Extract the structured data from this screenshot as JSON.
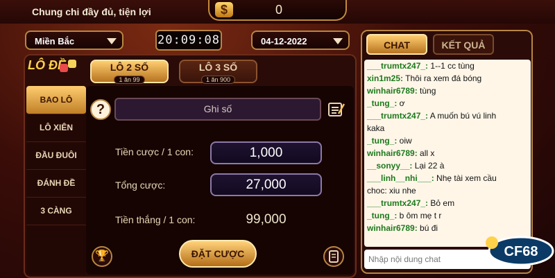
{
  "header": {
    "tagline": "Chung chi đầy đủ, tiện lợi",
    "currency_symbol": "$",
    "balance": "0"
  },
  "selectors": {
    "region": "Miền Bắc",
    "clock": "20:09:08",
    "date": "04-12-2022"
  },
  "brand": {
    "logo": "LÔ ĐỀ"
  },
  "tabs": [
    {
      "label": "LÔ 2 SỐ",
      "sub": "1 ăn 99"
    },
    {
      "label": "LÔ 3 SỐ",
      "sub": "1 ăn 900"
    }
  ],
  "sidebar": {
    "items": [
      {
        "label": "BAO LÔ"
      },
      {
        "label": "LÔ XIÊN"
      },
      {
        "label": "ĐẦU ĐUÔI"
      },
      {
        "label": "ĐÁNH ĐỀ"
      },
      {
        "label": "3 CÀNG"
      }
    ]
  },
  "form": {
    "ghi_so_placeholder": "Ghi số",
    "bet_per_label": "Tiền cược / 1 con:",
    "bet_per_value": "1,000",
    "total_label": "Tổng cược:",
    "total_value": "27,000",
    "win_label": "Tiền thắng / 1 con:",
    "win_value": "99,000",
    "submit": "ĐẶT CƯỢC"
  },
  "chat": {
    "tabs": [
      "CHAT",
      "KẾT QUẢ"
    ],
    "messages": [
      {
        "user": "___trumtx247_:",
        "text": " 1--1 cc tùng"
      },
      {
        "user": "xin1m25:",
        "text": " Thôi ra xem đá bóng"
      },
      {
        "user": "winhair6789:",
        "text": " tùng"
      },
      {
        "user": "_tung_:",
        "text": " ơ"
      },
      {
        "user": "___trumtx247_:",
        "text": " A muốn bú vú linh"
      },
      {
        "user": "",
        "text": "kaka"
      },
      {
        "user": "_tung_:",
        "text": " oiw"
      },
      {
        "user": "winhair6789:",
        "text": " all x"
      },
      {
        "user": "__sonyy__:",
        "text": " Lại 22 à"
      },
      {
        "user": "___linh__nhi___:",
        "text": " Nhẹ tài xem cầu"
      },
      {
        "user": "",
        "text": "choc: xiu nhe"
      },
      {
        "user": "___trumtx247_:",
        "text": " Bỏ em"
      },
      {
        "user": "_tung_:",
        "text": " b ôm mẹ t r"
      },
      {
        "user": "winhair6789:",
        "text": " bú đi"
      }
    ],
    "input_placeholder": "Nhập nội dung chat"
  },
  "watermark": {
    "text": "CF68"
  }
}
